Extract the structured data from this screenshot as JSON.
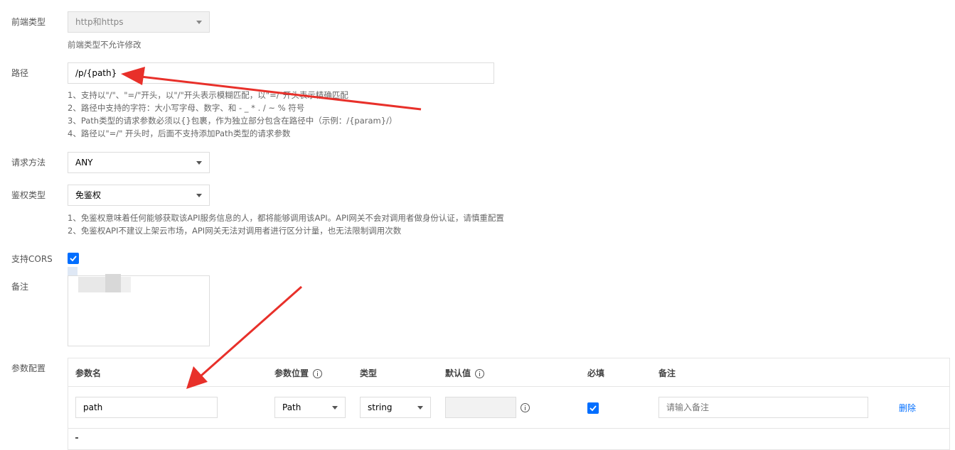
{
  "form": {
    "frontend_type": {
      "label": "前端类型",
      "value": "http和https",
      "note": "前端类型不允许修改"
    },
    "path": {
      "label": "路径",
      "value": "/p/{path}",
      "hints": [
        "1、支持以\"/\"、\"=/\"开头，以\"/\"开头表示模糊匹配，以\"=/\"开头表示精确匹配",
        "2、路径中支持的字符：大小写字母、数字、和 - _ * . / ~ % 符号",
        "3、Path类型的请求参数必须以{}包裹，作为独立部分包含在路径中（示例：/{param}/）",
        "4、路径以\"=/\" 开头时，后面不支持添加Path类型的请求参数"
      ]
    },
    "method": {
      "label": "请求方法",
      "value": "ANY"
    },
    "auth": {
      "label": "鉴权类型",
      "value": "免鉴权",
      "hints": [
        "1、免鉴权意味着任何能够获取该API服务信息的人，都将能够调用该API。API网关不会对调用者做身份认证，请慎重配置",
        "2、免鉴权API不建议上架云市场，API网关无法对调用者进行区分计量，也无法限制调用次数"
      ]
    },
    "cors": {
      "label": "支持CORS",
      "checked": true
    },
    "remark": {
      "label": "备注",
      "value": ""
    },
    "params": {
      "label": "参数配置",
      "headers": {
        "name": "参数名",
        "position": "参数位置",
        "type": "类型",
        "default": "默认值",
        "required": "必填",
        "remark": "备注"
      },
      "rows": [
        {
          "name": "path",
          "position": "Path",
          "type": "string",
          "default": "",
          "required": true,
          "remark_placeholder": "请输入备注",
          "delete": "删除"
        }
      ]
    }
  },
  "colors": {
    "accent": "#006eff",
    "arrow": "#e8302a"
  }
}
